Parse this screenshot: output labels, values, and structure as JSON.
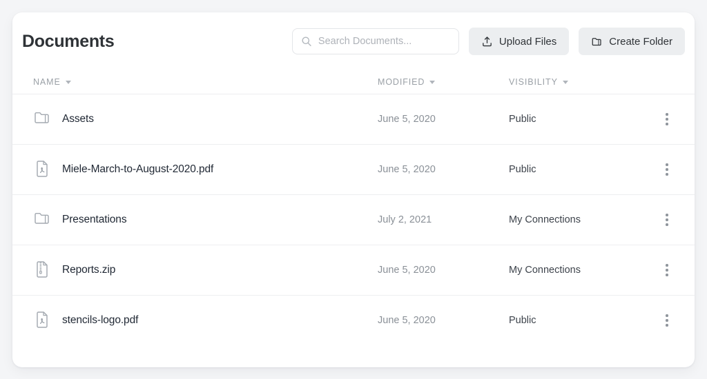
{
  "header": {
    "title": "Documents",
    "search": {
      "placeholder": "Search Documents...",
      "value": "",
      "icon": "search-icon"
    },
    "buttons": [
      {
        "label": "Upload Files",
        "icon": "upload-icon"
      },
      {
        "label": "Create Folder",
        "icon": "folder-plus-icon"
      }
    ]
  },
  "table": {
    "columns": [
      {
        "label": "NAME",
        "sort_icon": "caret-down-icon"
      },
      {
        "label": "MODIFIED",
        "sort_icon": "caret-down-icon"
      },
      {
        "label": "VISIBILITY",
        "sort_icon": "caret-down-icon"
      }
    ],
    "rows": [
      {
        "name": "Assets",
        "icon": "folder-icon",
        "modified": "June 5, 2020",
        "visibility": "Public",
        "menu_icon": "kebab-menu-icon"
      },
      {
        "name": "Miele-March-to-August-2020.pdf",
        "icon": "pdf-file-icon",
        "modified": "June 5, 2020",
        "visibility": "Public",
        "menu_icon": "kebab-menu-icon"
      },
      {
        "name": "Presentations",
        "icon": "folder-icon",
        "modified": "July 2, 2021",
        "visibility": "My Connections",
        "menu_icon": "kebab-menu-icon"
      },
      {
        "name": "Reports.zip",
        "icon": "zip-file-icon",
        "modified": "June 5, 2020",
        "visibility": "My Connections",
        "menu_icon": "kebab-menu-icon"
      },
      {
        "name": "stencils-logo.pdf",
        "icon": "pdf-file-icon",
        "modified": "June 5, 2020",
        "visibility": "Public",
        "menu_icon": "kebab-menu-icon"
      }
    ]
  },
  "colors": {
    "page_background": "#f4f5f7",
    "card_background": "#ffffff",
    "title_text": "#2f3337",
    "muted_text": "#8a9097",
    "column_header_text": "#9aa0a6",
    "row_divider": "#edeef0",
    "button_background": "#eceef0",
    "file_name_text": "#1f2733",
    "icon_stroke": "#9aa0a6"
  }
}
